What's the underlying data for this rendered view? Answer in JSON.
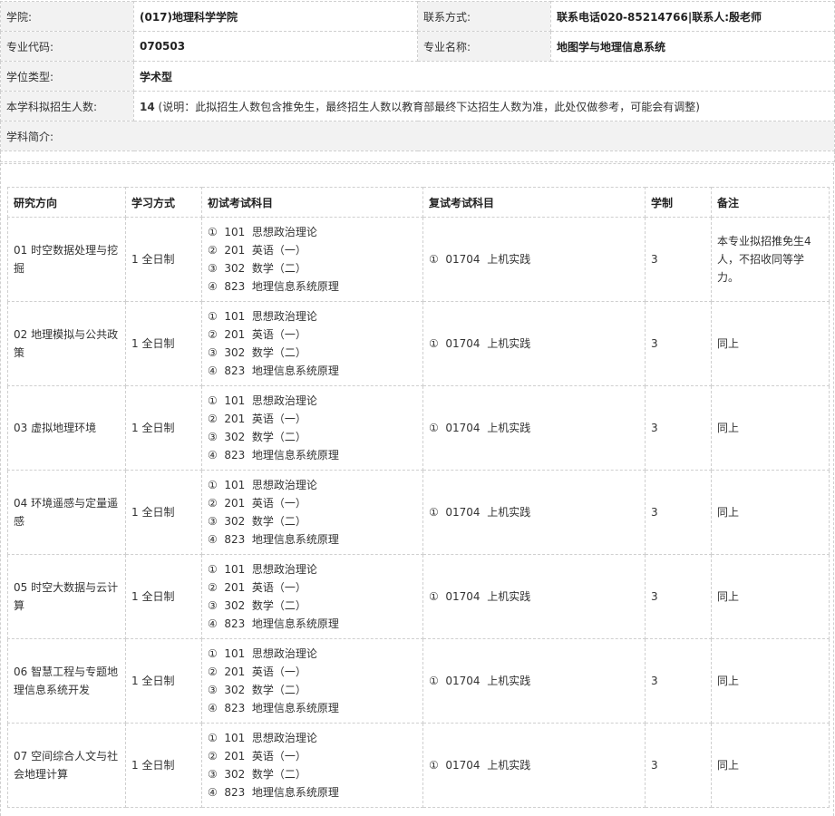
{
  "info": {
    "college_label": "学院:",
    "college_value": "(017)地理科学学院",
    "contact_label": "联系方式:",
    "contact_value": "联系电话020-85214766|联系人:殷老师",
    "major_code_label": "专业代码:",
    "major_code_value": "070503",
    "major_name_label": "专业名称:",
    "major_name_value": "地图学与地理信息系统",
    "degree_label": "学位类型:",
    "degree_value": "学术型",
    "enroll_label": "本学科拟招生人数:",
    "enroll_number": "14",
    "enroll_note": " (说明：此拟招生人数包含推免生，最终招生人数以教育部最终下达招生人数为准，此处仅做参考，可能会有调整)",
    "intro_label": "学科简介:"
  },
  "table": {
    "headers": [
      "研究方向",
      "学习方式",
      "初试考试科目",
      "复试考试科目",
      "学制",
      "备注"
    ],
    "rows": [
      {
        "direction": "01 时空数据处理与挖掘",
        "mode": "1 全日制",
        "subjects": [
          "①  101  思想政治理论",
          "②  201  英语（一）",
          "③  302  数学（二）",
          "④  823  地理信息系统原理"
        ],
        "retest": "①  01704  上机实践",
        "years": "3",
        "remark": "本专业拟招推免生4人，不招收同等学力。"
      },
      {
        "direction": "02 地理模拟与公共政策",
        "mode": "1 全日制",
        "subjects": [
          "①  101  思想政治理论",
          "②  201  英语（一）",
          "③  302  数学（二）",
          "④  823  地理信息系统原理"
        ],
        "retest": "①  01704  上机实践",
        "years": "3",
        "remark": "同上"
      },
      {
        "direction": "03 虚拟地理环境",
        "mode": "1 全日制",
        "subjects": [
          "①  101  思想政治理论",
          "②  201  英语（一）",
          "③  302  数学（二）",
          "④  823  地理信息系统原理"
        ],
        "retest": "①  01704  上机实践",
        "years": "3",
        "remark": "同上"
      },
      {
        "direction": "04 环境遥感与定量遥感",
        "mode": "1 全日制",
        "subjects": [
          "①  101  思想政治理论",
          "②  201  英语（一）",
          "③  302  数学（二）",
          "④  823  地理信息系统原理"
        ],
        "retest": "①  01704  上机实践",
        "years": "3",
        "remark": "同上"
      },
      {
        "direction": "05 时空大数据与云计算",
        "mode": "1 全日制",
        "subjects": [
          "①  101  思想政治理论",
          "②  201  英语（一）",
          "③  302  数学（二）",
          "④  823  地理信息系统原理"
        ],
        "retest": "①  01704  上机实践",
        "years": "3",
        "remark": "同上"
      },
      {
        "direction": "06 智慧工程与专题地理信息系统开发",
        "mode": "1 全日制",
        "subjects": [
          "①  101  思想政治理论",
          "②  201  英语（一）",
          "③  302  数学（二）",
          "④  823  地理信息系统原理"
        ],
        "retest": "①  01704  上机实践",
        "years": "3",
        "remark": "同上"
      },
      {
        "direction": "07 空间综合人文与社会地理计算",
        "mode": "1 全日制",
        "subjects": [
          "①  101  思想政治理论",
          "②  201  英语（一）",
          "③  302  数学（二）",
          "④  823  地理信息系统原理"
        ],
        "retest": "①  01704  上机实践",
        "years": "3",
        "remark": "同上"
      }
    ]
  }
}
